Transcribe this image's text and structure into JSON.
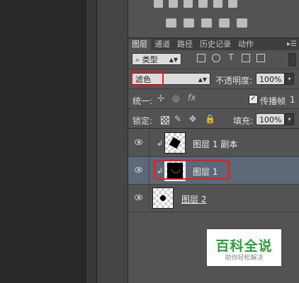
{
  "tabs": [
    "图层",
    "通道",
    "路径",
    "历史记录",
    "动作"
  ],
  "filter": {
    "kind_label": "类型"
  },
  "blend": {
    "mode": "滤色",
    "opacity_label": "不透明度:",
    "opacity_value": "100%"
  },
  "unify": {
    "label": "统一:",
    "propagate_label": "传播帧",
    "propagate_count": "1"
  },
  "lock": {
    "label": "锁定:",
    "fill_label": "填充:",
    "fill_value": "100%"
  },
  "layers": [
    {
      "name": "图层 1 副本",
      "selected": false,
      "clipped": true
    },
    {
      "name": "图层 1",
      "selected": true,
      "clipped": true
    },
    {
      "name": "图层 2",
      "selected": false,
      "clipped": false
    }
  ],
  "watermark": {
    "title": "百科全说",
    "subtitle": "助你轻松解决"
  },
  "colors": {
    "selection_highlight": "#d22222",
    "selected_layer": "#5d6878",
    "watermark_green": "#2d9b3a"
  }
}
